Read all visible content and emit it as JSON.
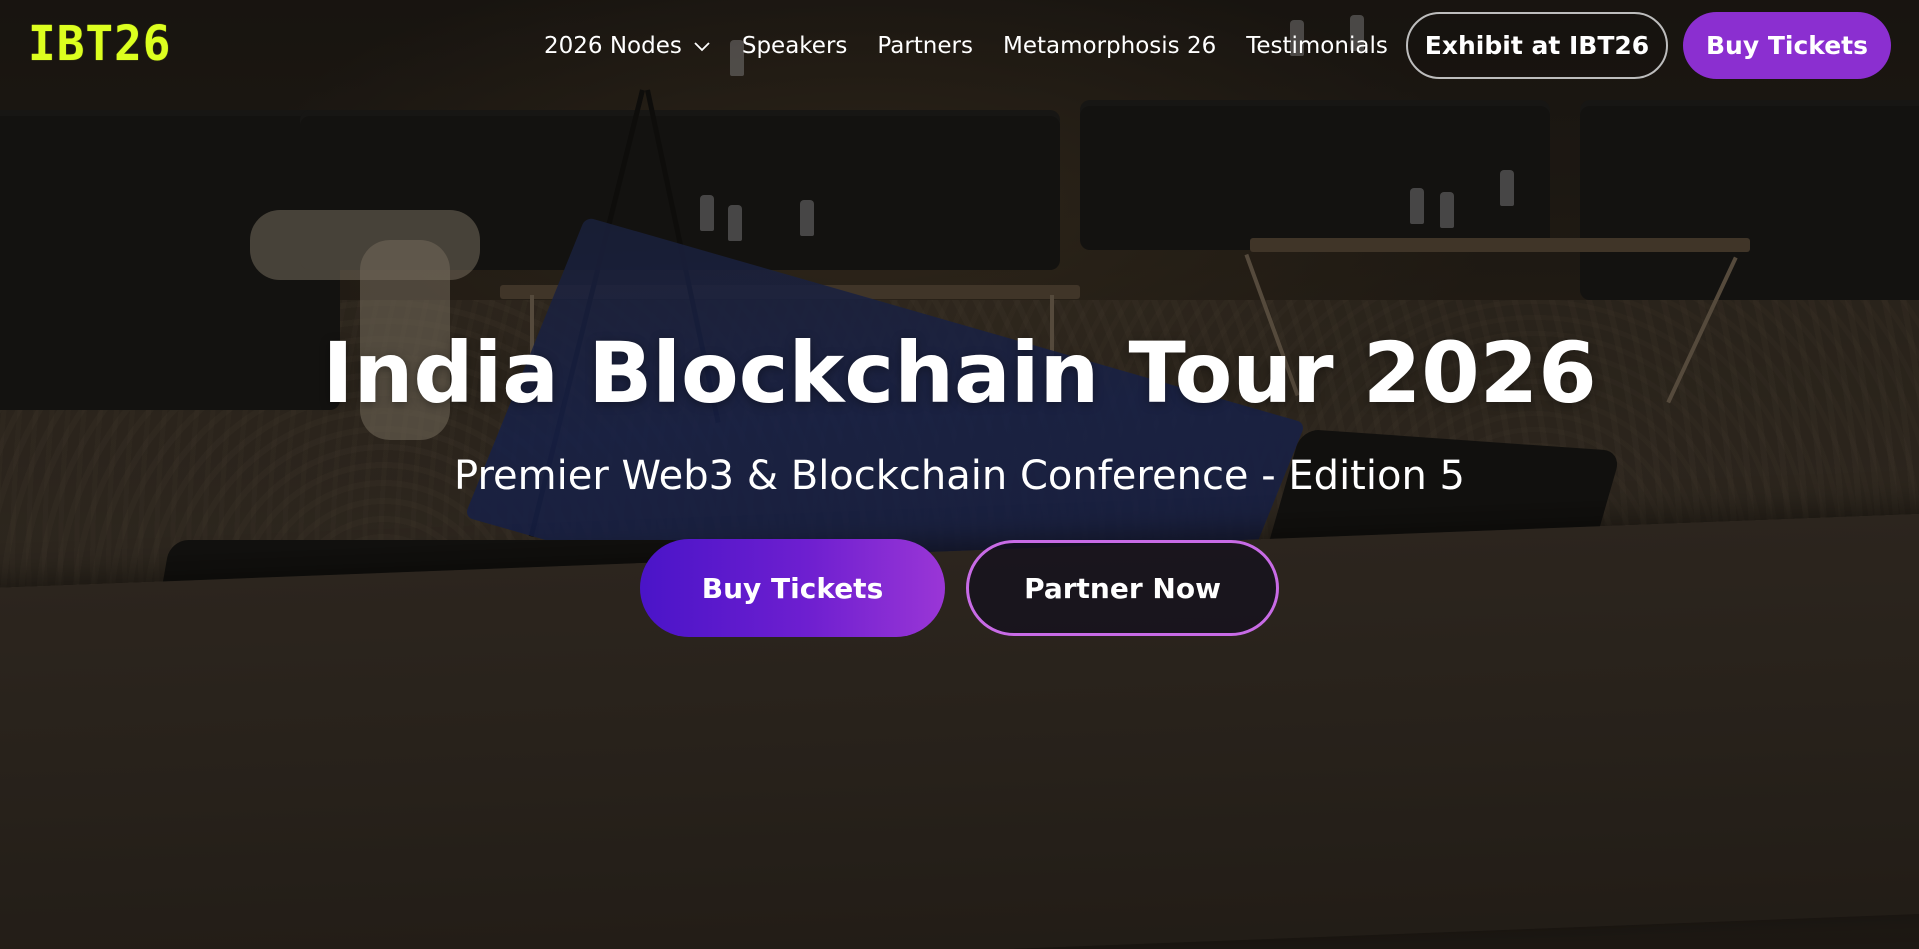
{
  "logo": {
    "text": "IBT26",
    "color": "#dcff1f"
  },
  "nav": {
    "items": [
      {
        "label": "2026 Nodes",
        "has_dropdown": true,
        "icon": "chevron-down-icon"
      },
      {
        "label": "Speakers"
      },
      {
        "label": "Partners"
      },
      {
        "label": "Metamorphosis 26"
      },
      {
        "label": "Testimonials"
      }
    ]
  },
  "header": {
    "exhibit_label": "Exhibit at IBT26",
    "buy_tickets_label": "Buy Tickets"
  },
  "hero": {
    "title": "India Blockchain Tour 2026",
    "subtitle": "Premier Web3 & Blockchain Conference - Edition 5",
    "buy_tickets_label": "Buy Tickets",
    "partner_label": "Partner Now"
  },
  "colors": {
    "accent_purple": "#8b2fd0",
    "gradient_start": "#4a14c8",
    "gradient_end": "#9a36d6",
    "partner_border": "#c86be6"
  }
}
